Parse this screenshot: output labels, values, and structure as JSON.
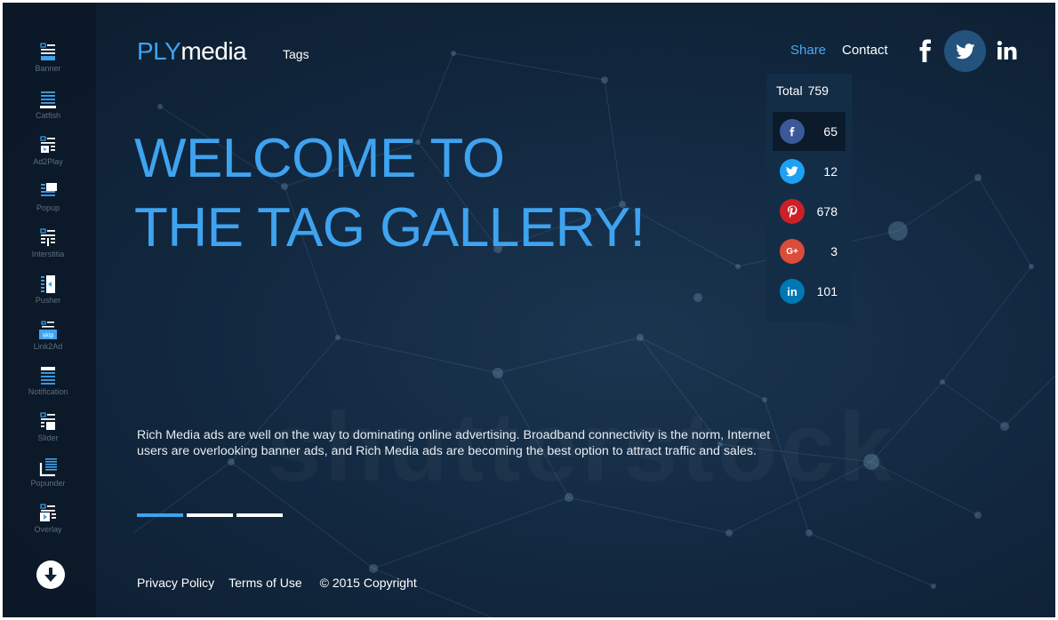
{
  "sidebar": {
    "items": [
      {
        "label": "Banner",
        "icon": "banner-icon"
      },
      {
        "label": "Catfish",
        "icon": "catfish-icon"
      },
      {
        "label": "Ad2Play",
        "icon": "ad2play-icon"
      },
      {
        "label": "Popup",
        "icon": "popup-icon"
      },
      {
        "label": "Interstitia",
        "icon": "interstitial-icon"
      },
      {
        "label": "Pusher",
        "icon": "pusher-icon"
      },
      {
        "label": "Link2Ad",
        "icon": "link2ad-icon",
        "badge": "skip"
      },
      {
        "label": "Notification",
        "icon": "notification-icon"
      },
      {
        "label": "Slider",
        "icon": "slider-icon"
      },
      {
        "label": "Popunder",
        "icon": "popunder-icon"
      },
      {
        "label": "Overlay",
        "icon": "overlay-icon"
      }
    ],
    "scroll_down_icon": "arrow-down-icon"
  },
  "header": {
    "logo_part1": "PLY",
    "logo_part2": "media",
    "nav_tags": "Tags",
    "nav_share": "Share",
    "nav_contact": "Contact",
    "social": [
      "facebook-icon",
      "twitter-icon",
      "linkedin-icon"
    ]
  },
  "share": {
    "total_label": "Total",
    "total_value": "759",
    "networks": [
      {
        "name": "facebook",
        "count": "65",
        "color": "#3b5998",
        "glyph": "f"
      },
      {
        "name": "twitter",
        "count": "12",
        "color": "#1da1f2",
        "glyph": ""
      },
      {
        "name": "pinterest",
        "count": "678",
        "color": "#cb2027",
        "glyph": "p"
      },
      {
        "name": "google-plus",
        "count": "3",
        "color": "#dd4b39",
        "glyph": "G+"
      },
      {
        "name": "linkedin",
        "count": "101",
        "color": "#0077b5",
        "glyph": "in"
      }
    ]
  },
  "hero": {
    "line1": "WELCOME TO",
    "line2": "THE TAG GALLERY!",
    "description": "Rich Media ads are well on the way to dominating online advertising. Broadband connectivity is the norm, Internet users are overlooking banner ads, and Rich Media ads are becoming the best option to attract traffic and sales.",
    "slides_total": 3,
    "slides_active": 1
  },
  "footer": {
    "privacy": "Privacy Policy",
    "terms": "Terms of Use",
    "copyright": "© 2015 Copyright"
  },
  "colors": {
    "accent": "#3ea3f0",
    "background": "#132a42",
    "sidebar": "#0a1826",
    "share_panel": "#132d47"
  }
}
